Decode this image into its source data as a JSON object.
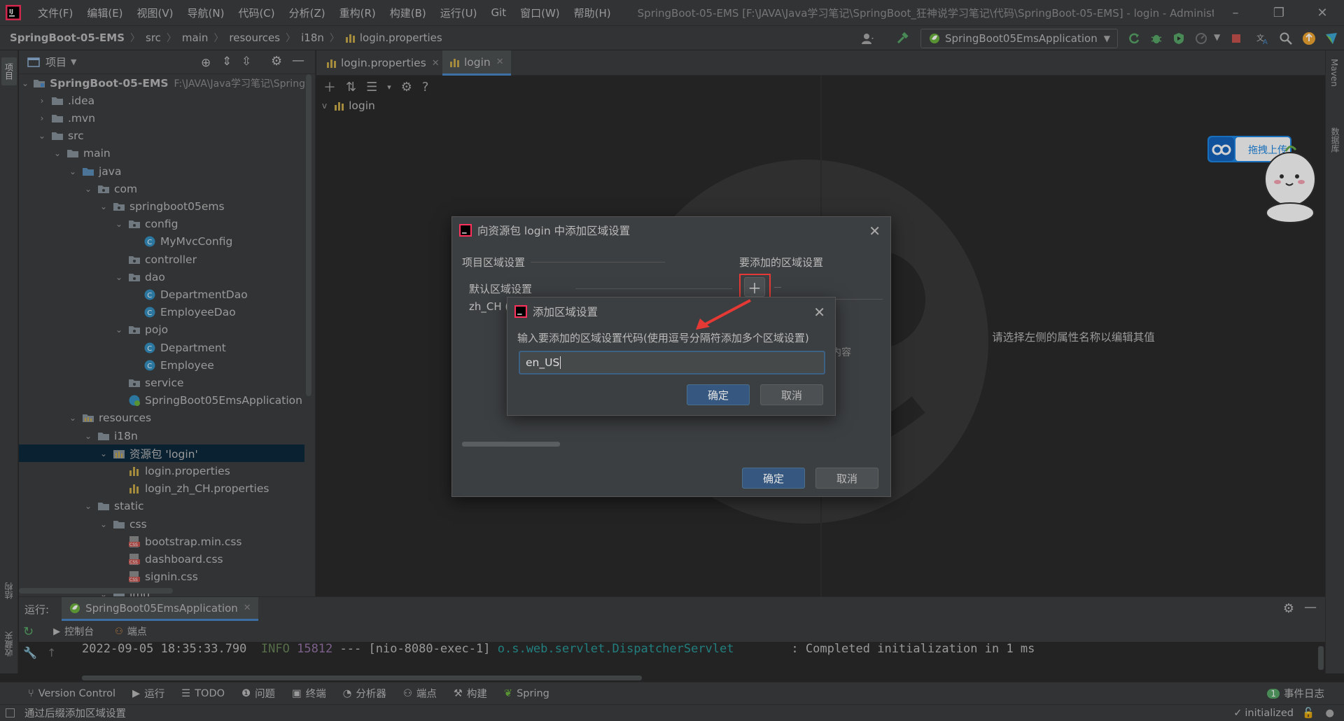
{
  "menubar": {
    "items": [
      "文件(F)",
      "编辑(E)",
      "视图(V)",
      "导航(N)",
      "代码(C)",
      "分析(Z)",
      "重构(R)",
      "构建(B)",
      "运行(U)",
      "Git",
      "窗口(W)",
      "帮助(H)"
    ],
    "window_title": "SpringBoot-05-EMS [F:\\JAVA\\Java学习笔记\\SpringBoot_狂神说学习笔记\\代码\\SpringBoot-05-EMS] - login - Administrator"
  },
  "navbar": {
    "crumbs": [
      "SpringBoot-05-EMS",
      "src",
      "main",
      "resources",
      "i18n",
      "login.properties"
    ],
    "run_config": "SpringBoot05EmsApplication"
  },
  "project": {
    "header": "项目",
    "tree": [
      {
        "label": "SpringBoot-05-EMS",
        "extra": "F:\\JAVA\\Java学习笔记\\SpringB",
        "level": 0,
        "chev": "v",
        "icon": "module"
      },
      {
        "label": ".idea",
        "level": 1,
        "chev": ">",
        "icon": "folder"
      },
      {
        "label": ".mvn",
        "level": 1,
        "chev": ">",
        "icon": "folder"
      },
      {
        "label": "src",
        "level": 1,
        "chev": "v",
        "icon": "folder"
      },
      {
        "label": "main",
        "level": 2,
        "chev": "v",
        "icon": "folder"
      },
      {
        "label": "java",
        "level": 3,
        "chev": "v",
        "icon": "folder-blue"
      },
      {
        "label": "com",
        "level": 4,
        "chev": "v",
        "icon": "package"
      },
      {
        "label": "springboot05ems",
        "level": 5,
        "chev": "v",
        "icon": "package"
      },
      {
        "label": "config",
        "level": 6,
        "chev": "v",
        "icon": "package"
      },
      {
        "label": "MyMvcConfig",
        "level": 7,
        "chev": "",
        "icon": "class"
      },
      {
        "label": "controller",
        "level": 6,
        "chev": "",
        "icon": "package"
      },
      {
        "label": "dao",
        "level": 6,
        "chev": "v",
        "icon": "package"
      },
      {
        "label": "DepartmentDao",
        "level": 7,
        "chev": "",
        "icon": "class"
      },
      {
        "label": "EmployeeDao",
        "level": 7,
        "chev": "",
        "icon": "class"
      },
      {
        "label": "pojo",
        "level": 6,
        "chev": "v",
        "icon": "package"
      },
      {
        "label": "Department",
        "level": 7,
        "chev": "",
        "icon": "class"
      },
      {
        "label": "Employee",
        "level": 7,
        "chev": "",
        "icon": "class"
      },
      {
        "label": "service",
        "level": 6,
        "chev": "",
        "icon": "package"
      },
      {
        "label": "SpringBoot05EmsApplication",
        "level": 6,
        "chev": "",
        "icon": "spring"
      },
      {
        "label": "resources",
        "level": 3,
        "chev": "v",
        "icon": "folder-res"
      },
      {
        "label": "i18n",
        "level": 4,
        "chev": "v",
        "icon": "folder"
      },
      {
        "label": "资源包 'login'",
        "level": 5,
        "chev": "v",
        "icon": "bundle",
        "selected": true
      },
      {
        "label": "login.properties",
        "level": 6,
        "chev": "",
        "icon": "props"
      },
      {
        "label": "login_zh_CH.properties",
        "level": 6,
        "chev": "",
        "icon": "props"
      },
      {
        "label": "static",
        "level": 4,
        "chev": "v",
        "icon": "folder"
      },
      {
        "label": "css",
        "level": 5,
        "chev": "v",
        "icon": "folder"
      },
      {
        "label": "bootstrap.min.css",
        "level": 6,
        "chev": "",
        "icon": "css"
      },
      {
        "label": "dashboard.css",
        "level": 6,
        "chev": "",
        "icon": "css"
      },
      {
        "label": "signin.css",
        "level": 6,
        "chev": "",
        "icon": "css"
      },
      {
        "label": "img",
        "level": 5,
        "chev": "v",
        "icon": "folder"
      }
    ]
  },
  "editor": {
    "tabs": [
      {
        "label": "login.properties",
        "active": false
      },
      {
        "label": "login",
        "active": true
      }
    ],
    "bundle_node": "login",
    "hint": "请选择左侧的属性名称以编辑其值"
  },
  "outer_dialog": {
    "title": "向资源包 login 中添加区域设置",
    "left_header": "项目区域设置",
    "right_header": "要添加的区域设置",
    "items": [
      "默认区域设置",
      "zh_CH ("
    ],
    "behind_text": "内容",
    "ok": "确定",
    "cancel": "取消"
  },
  "inner_dialog": {
    "title": "添加区域设置",
    "prompt": "输入要添加的区域设置代码(使用逗号分隔符添加多个区域设置)",
    "input_value": "en_US",
    "ok": "确定",
    "cancel": "取消"
  },
  "run": {
    "label": "运行:",
    "config_tab": "SpringBoot05EmsApplication",
    "subtabs": [
      "控制台",
      "端点"
    ],
    "log": {
      "timestamp": "2022-09-05 18:35:33.790",
      "level": "INFO",
      "pid": "15812",
      "sep": "---",
      "thread": "[nio-8080-exec-1]",
      "logger": "o.s.web.servlet.DispatcherServlet",
      "message": ": Completed initialization in 1 ms"
    }
  },
  "bottom_tools": [
    "Version Control",
    "运行",
    "TODO",
    "问题",
    "终端",
    "分析器",
    "端点",
    "构建",
    "Spring"
  ],
  "event_log": {
    "count": "1",
    "label": "事件日志"
  },
  "status": {
    "message": "通过后缀添加区域设置",
    "right": "initialized"
  },
  "side_labels": {
    "left_top": "项目",
    "left_bottom1": "结构",
    "left_bottom2": "收藏夹",
    "right1": "Maven",
    "right2": "数据库"
  },
  "widget": {
    "text": "拖拽上传"
  },
  "colors": {
    "accent": "#365880",
    "selection": "#0d293e",
    "highlight_box": "#e53935",
    "arrow": "#e53935",
    "log_info": "#6a8759",
    "log_pid": "#9876aa",
    "log_logger": "#2b9b9b"
  }
}
